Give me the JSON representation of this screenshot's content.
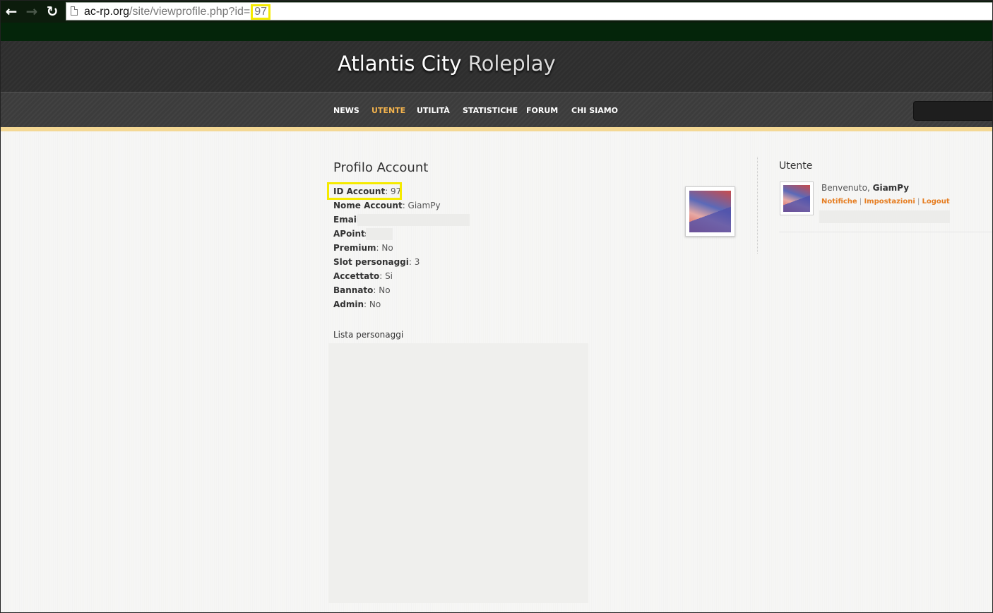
{
  "browser": {
    "back_icon": "back-arrow-icon",
    "forward_icon": "forward-arrow-icon",
    "reload_icon": "reload-icon",
    "url_domain": "ac-rp.org",
    "url_path": "/site/viewprofile.php?id=",
    "url_id": "97"
  },
  "header": {
    "title_main": "Atlantis City",
    "title_sub": "Roleplay"
  },
  "nav": {
    "items": [
      "NEWS",
      "UTENTE",
      "UTILITÀ",
      "STATISTICHE",
      "FORUM",
      "CHI SIAMO"
    ],
    "active": "UTENTE",
    "active_color": "#f3b34d"
  },
  "profile": {
    "title": "Profilo Account",
    "fields": [
      {
        "label": "ID Account",
        "value": "97"
      },
      {
        "label": "Nome Account",
        "value": "GiamPy"
      },
      {
        "label": "Email",
        "value": ""
      },
      {
        "label": "APoints",
        "value": ""
      },
      {
        "label": "Premium",
        "value": "No"
      },
      {
        "label": "Slot personaggi",
        "value": "3"
      },
      {
        "label": "Accettato",
        "value": "Si"
      },
      {
        "label": "Bannato",
        "value": "No"
      },
      {
        "label": "Admin",
        "value": "No"
      }
    ],
    "characters_title": "Lista personaggi"
  },
  "sidebar": {
    "title": "Utente",
    "welcome_prefix": "Benvenuto,",
    "username": "GiamPy",
    "links": [
      "Notifiche",
      "Impostazioni",
      "Logout"
    ],
    "link_color": "#e67e22"
  },
  "colors": {
    "highlight": "#f5ea00",
    "accent_line": "#f4d894"
  }
}
